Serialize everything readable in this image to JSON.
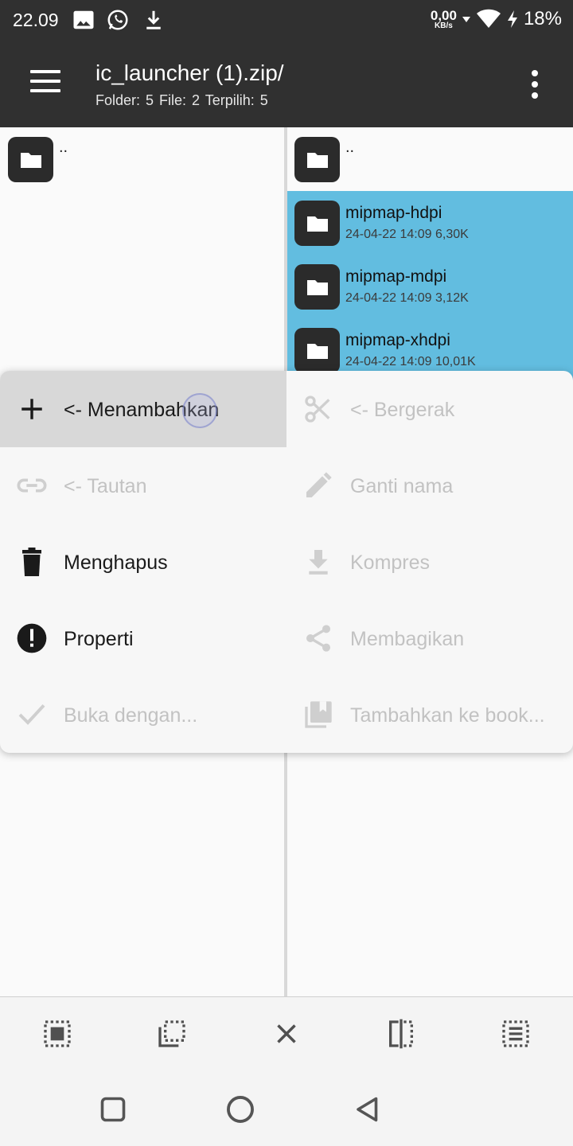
{
  "status_bar": {
    "time": "22.09",
    "net_speed": "0,00",
    "net_unit": "KB/s",
    "battery": "18%",
    "icons": [
      "image-icon",
      "whatsapp-icon",
      "download-icon",
      "wifi-icon",
      "charging-icon"
    ]
  },
  "app_bar": {
    "title": "ic_launcher (1).zip/",
    "subtitle": "Folder: 5  File: 2  Terpilih: 5"
  },
  "left_pane": {
    "items": [
      {
        "name": ".."
      }
    ]
  },
  "right_pane": {
    "items": [
      {
        "name": ".."
      },
      {
        "name": "mipmap-hdpi",
        "meta": "24-04-22 14:09  6,30K",
        "selected": true
      },
      {
        "name": "mipmap-mdpi",
        "meta": "24-04-22 14:09  3,12K",
        "selected": true
      },
      {
        "name": "mipmap-xhdpi",
        "meta": "24-04-22 14:09  10,01K",
        "selected": true
      }
    ]
  },
  "menu": {
    "items": [
      {
        "label": "<- Menambahkan",
        "icon": "plus-icon",
        "enabled": true
      },
      {
        "label": "<- Bergerak",
        "icon": "scissors-icon",
        "enabled": false
      },
      {
        "label": "<- Tautan",
        "icon": "link-icon",
        "enabled": false
      },
      {
        "label": "Ganti nama",
        "icon": "pencil-icon",
        "enabled": false
      },
      {
        "label": "Menghapus",
        "icon": "trash-icon",
        "enabled": true
      },
      {
        "label": "Kompres",
        "icon": "compress-icon",
        "enabled": false
      },
      {
        "label": "Properti",
        "icon": "info-icon",
        "enabled": true
      },
      {
        "label": "Membagikan",
        "icon": "share-icon",
        "enabled": false
      },
      {
        "label": "Buka dengan...",
        "icon": "check-icon",
        "enabled": false
      },
      {
        "label": "Tambahkan ke book...",
        "icon": "bookmark-library-icon",
        "enabled": false
      }
    ]
  },
  "bottom_toolbar": {
    "icons": [
      "select-all-icon",
      "deselect-icon",
      "close-icon",
      "compare-icon",
      "select-list-icon"
    ]
  },
  "colors": {
    "header": "#303030",
    "selection": "#62bde0",
    "folder_icon_bg": "#2b2b2b",
    "menu_active": "#d8d8d8",
    "disabled_text": "#c2c2c2"
  }
}
